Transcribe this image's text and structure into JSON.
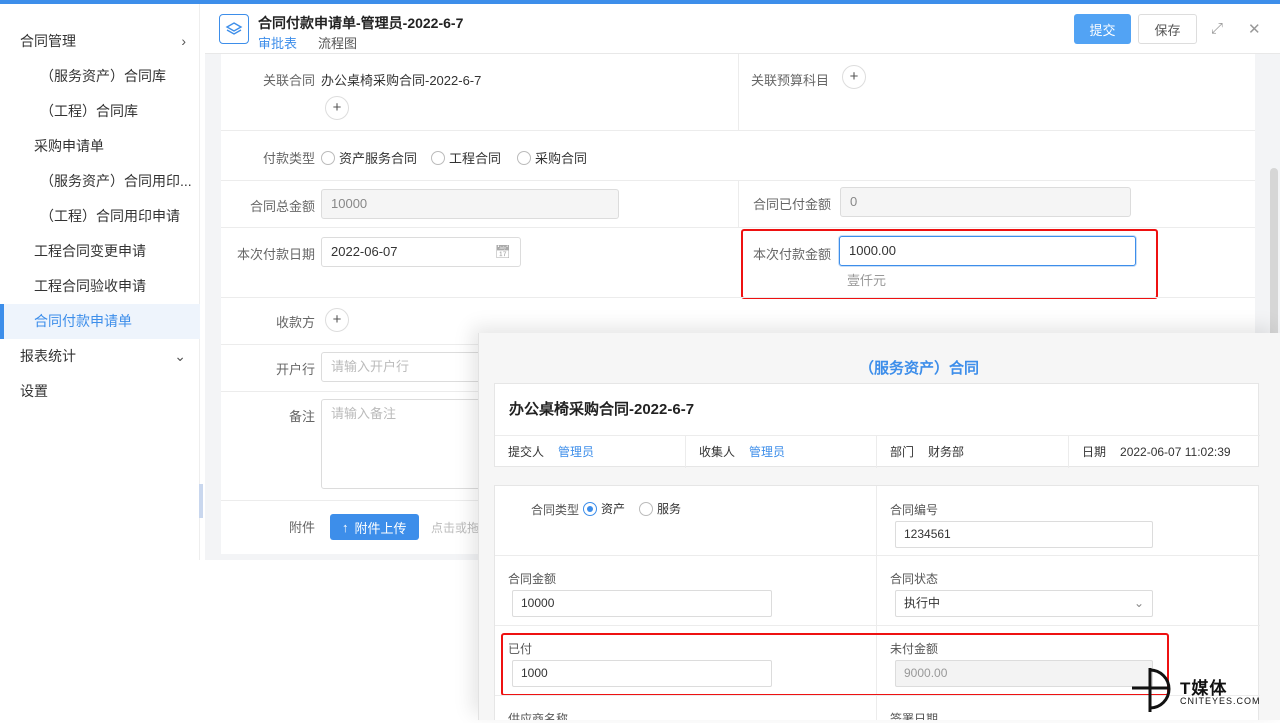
{
  "sidebar": {
    "items": [
      {
        "label": "合同管理",
        "arrow": "chevron-right"
      },
      {
        "label": "（服务资产）合同库"
      },
      {
        "label": "（工程）合同库"
      },
      {
        "label": "采购申请单"
      },
      {
        "label": "（服务资产）合同用印..."
      },
      {
        "label": "（工程）合同用印申请"
      },
      {
        "label": "工程合同变更申请"
      },
      {
        "label": "工程合同验收申请"
      },
      {
        "label": "合同付款申请单",
        "active": true
      },
      {
        "label": "报表统计",
        "arrow": "chevron-down"
      },
      {
        "label": "设置"
      }
    ]
  },
  "header": {
    "title": "合同付款申请单-管理员-2022-6-7",
    "tabs": [
      "审批表",
      "流程图"
    ],
    "submit_label": "提交",
    "save_label": "保存"
  },
  "form": {
    "related_contract_label": "关联合同",
    "related_contract_value": "办公桌椅采购合同-2022-6-7",
    "budget_label": "关联预算科目",
    "payment_type_label": "付款类型",
    "payment_type_options": [
      "资产服务合同",
      "工程合同",
      "采购合同"
    ],
    "total_amount_label": "合同总金额",
    "total_amount_value": "10000",
    "paid_amount_label": "合同已付金额",
    "paid_amount_value": "0",
    "pay_date_label": "本次付款日期",
    "pay_date_value": "2022-06-07",
    "pay_amount_label": "本次付款金额",
    "pay_amount_value": "1000.00",
    "pay_amount_upper": "壹仟元",
    "payee_label": "收款方",
    "bank_label": "开户行",
    "bank_placeholder": "请输入开户行",
    "remark_label": "备注",
    "remark_placeholder": "请输入备注",
    "attachment_label": "附件",
    "upload_label": "附件上传",
    "upload_hint": "点击或拖"
  },
  "overlay": {
    "title": "（服务资产）合同",
    "contract_name": "办公桌椅采购合同-2022-6-7",
    "submitter_label": "提交人",
    "submitter_value": "管理员",
    "collector_label": "收集人",
    "collector_value": "管理员",
    "dept_label": "部门",
    "dept_value": "财务部",
    "date_label": "日期",
    "date_value": "2022-06-07 11:02:39",
    "contract_type_label": "合同类型",
    "contract_type_options": [
      "资产",
      "服务"
    ],
    "contract_no_label": "合同编号",
    "contract_no_value": "1234561",
    "amount_label": "合同金额",
    "amount_value": "10000",
    "status_label": "合同状态",
    "status_value": "执行中",
    "paid_label": "已付",
    "paid_value": "1000",
    "unpaid_label": "未付金额",
    "unpaid_value": "9000.00",
    "supplier_label": "供应商名称",
    "sign_date_label": "签署日期"
  },
  "watermark": {
    "text": "T媒体",
    "sub": "CNITEYES.COM"
  }
}
